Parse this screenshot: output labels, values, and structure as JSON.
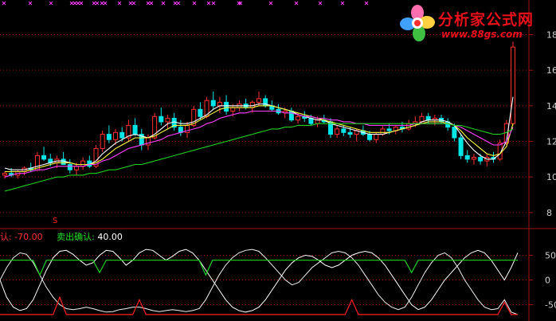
{
  "watermark": {
    "title": "分析家公式网",
    "url": "www.88gs.com",
    "logo": "flower-logo-icon"
  },
  "colors": {
    "background": "#000000",
    "up": "#ff3030",
    "down": "#00e5e5",
    "ma_short": "#ffffff",
    "ma_mid": "#ffff40",
    "ma_long": "#ff40ff",
    "ma_slow": "#20d020",
    "osc_a": "#ffffff",
    "osc_b": "#f0f0f0",
    "buy_line": "#20d020",
    "sell_line": "#ff2020",
    "grid": "#a01010"
  },
  "legend": {
    "buy_label": "认: ",
    "buy_value": "-70.00",
    "sell_label": "卖出确认: ",
    "sell_value": "40.00"
  },
  "signal_marker": "S",
  "chart_data": [
    {
      "type": "candlestick",
      "title": "",
      "ytick_labels": [
        "18",
        "16",
        "14",
        "12",
        "10",
        "8"
      ],
      "ylim": [
        7.5,
        19.5
      ],
      "grid": true,
      "candles": [
        [
          10.1,
          10.3,
          9.9,
          10.2
        ],
        [
          10.2,
          10.5,
          10.0,
          10.1
        ],
        [
          10.1,
          10.4,
          9.9,
          10.3
        ],
        [
          10.3,
          10.6,
          10.1,
          10.5
        ],
        [
          10.5,
          10.8,
          10.3,
          10.4
        ],
        [
          10.4,
          11.4,
          10.3,
          11.2
        ],
        [
          11.2,
          11.7,
          10.9,
          11.0
        ],
        [
          11.0,
          11.3,
          10.6,
          10.8
        ],
        [
          10.8,
          11.2,
          10.5,
          11.0
        ],
        [
          11.0,
          11.4,
          10.8,
          10.7
        ],
        [
          10.7,
          11.0,
          10.2,
          10.4
        ],
        [
          10.4,
          10.8,
          10.1,
          10.6
        ],
        [
          10.6,
          11.1,
          10.4,
          10.9
        ],
        [
          10.9,
          11.2,
          10.5,
          10.6
        ],
        [
          10.6,
          11.8,
          10.5,
          11.6
        ],
        [
          11.6,
          12.6,
          11.4,
          12.4
        ],
        [
          12.4,
          12.9,
          11.9,
          12.1
        ],
        [
          12.1,
          12.7,
          11.8,
          12.5
        ],
        [
          12.5,
          12.8,
          12.0,
          12.2
        ],
        [
          12.2,
          13.2,
          12.0,
          12.9
        ],
        [
          12.9,
          13.3,
          12.3,
          12.4
        ],
        [
          12.4,
          12.7,
          11.5,
          11.8
        ],
        [
          11.8,
          12.4,
          11.5,
          12.2
        ],
        [
          12.2,
          13.6,
          12.1,
          13.4
        ],
        [
          13.4,
          13.9,
          12.9,
          13.1
        ],
        [
          13.1,
          13.5,
          12.7,
          13.3
        ],
        [
          13.3,
          13.6,
          12.6,
          12.8
        ],
        [
          12.8,
          13.2,
          12.3,
          12.5
        ],
        [
          12.5,
          13.1,
          12.2,
          12.9
        ],
        [
          12.9,
          14.0,
          12.8,
          13.8
        ],
        [
          13.8,
          14.2,
          13.2,
          13.4
        ],
        [
          13.4,
          14.5,
          13.3,
          14.3
        ],
        [
          14.3,
          14.8,
          13.8,
          14.0
        ],
        [
          14.0,
          14.5,
          13.6,
          14.2
        ],
        [
          14.2,
          14.6,
          13.5,
          13.7
        ],
        [
          13.7,
          14.1,
          13.4,
          13.9
        ],
        [
          13.9,
          14.3,
          13.7,
          14.1
        ],
        [
          14.1,
          14.4,
          13.8,
          13.9
        ],
        [
          13.9,
          14.3,
          13.6,
          14.2
        ],
        [
          14.2,
          14.8,
          14.0,
          14.4
        ],
        [
          14.4,
          14.6,
          13.9,
          14.0
        ],
        [
          14.0,
          14.3,
          13.7,
          13.8
        ],
        [
          13.8,
          14.1,
          13.5,
          13.6
        ],
        [
          13.6,
          13.9,
          13.3,
          13.7
        ],
        [
          13.7,
          13.9,
          13.1,
          13.2
        ],
        [
          13.2,
          13.6,
          13.0,
          13.4
        ],
        [
          13.4,
          13.7,
          13.1,
          13.3
        ],
        [
          13.3,
          13.5,
          12.9,
          13.0
        ],
        [
          13.0,
          13.4,
          12.8,
          13.2
        ],
        [
          13.2,
          13.5,
          13.0,
          13.1
        ],
        [
          13.1,
          13.3,
          12.2,
          12.4
        ],
        [
          12.4,
          12.9,
          12.2,
          12.7
        ],
        [
          12.7,
          12.9,
          12.3,
          12.5
        ],
        [
          12.5,
          12.8,
          12.2,
          12.4
        ],
        [
          12.4,
          12.7,
          12.0,
          12.6
        ],
        [
          12.6,
          12.9,
          12.3,
          12.4
        ],
        [
          12.4,
          12.6,
          12.0,
          12.1
        ],
        [
          12.1,
          12.5,
          11.9,
          12.4
        ],
        [
          12.4,
          12.9,
          12.3,
          12.7
        ],
        [
          12.7,
          13.0,
          12.4,
          12.6
        ],
        [
          12.6,
          12.9,
          12.4,
          12.8
        ],
        [
          12.8,
          13.1,
          12.5,
          12.7
        ],
        [
          12.7,
          13.2,
          12.6,
          13.0
        ],
        [
          13.0,
          13.4,
          12.8,
          13.1
        ],
        [
          13.1,
          13.6,
          13.0,
          13.4
        ],
        [
          13.4,
          13.6,
          13.0,
          13.2
        ],
        [
          13.2,
          13.5,
          12.9,
          13.3
        ],
        [
          13.3,
          13.5,
          13.0,
          13.1
        ],
        [
          13.1,
          13.3,
          12.6,
          12.8
        ],
        [
          12.8,
          13.0,
          12.0,
          12.2
        ],
        [
          12.2,
          12.4,
          11.0,
          11.2
        ],
        [
          11.2,
          11.5,
          10.8,
          11.0
        ],
        [
          11.0,
          11.3,
          10.7,
          11.1
        ],
        [
          11.1,
          11.3,
          10.7,
          10.9
        ],
        [
          10.9,
          11.3,
          10.6,
          11.1
        ],
        [
          11.1,
          11.4,
          10.8,
          11.0
        ],
        [
          11.0,
          12.1,
          10.9,
          11.9
        ],
        [
          11.9,
          13.2,
          11.8,
          13.0
        ],
        [
          13.0,
          17.6,
          12.9,
          17.3
        ]
      ],
      "series": [
        {
          "name": "",
          "values": [
            10.5,
            10.4,
            10.4,
            10.4,
            10.5,
            10.6,
            10.7,
            10.8,
            10.9,
            10.9,
            10.8,
            10.7,
            10.7,
            10.7,
            10.9,
            11.3,
            11.6,
            11.9,
            12.1,
            12.3,
            12.4,
            12.3,
            12.2,
            12.4,
            12.7,
            13.0,
            13.1,
            13.0,
            13.0,
            13.1,
            13.3,
            13.5,
            13.8,
            14.0,
            14.0,
            14.0,
            14.0,
            14.0,
            14.0,
            14.1,
            14.1,
            14.0,
            13.9,
            13.8,
            13.7,
            13.5,
            13.4,
            13.3,
            13.2,
            13.2,
            13.0,
            12.9,
            12.8,
            12.7,
            12.6,
            12.5,
            12.4,
            12.4,
            12.4,
            12.5,
            12.6,
            12.7,
            12.8,
            12.9,
            13.1,
            13.2,
            13.2,
            13.2,
            13.1,
            12.9,
            12.4,
            11.9,
            11.5,
            11.2,
            11.0,
            11.0,
            11.3,
            12.0,
            14.5
          ]
        },
        {
          "name": "",
          "values": [
            10.3,
            10.3,
            10.3,
            10.3,
            10.4,
            10.5,
            10.6,
            10.7,
            10.8,
            10.8,
            10.8,
            10.7,
            10.7,
            10.7,
            10.8,
            11.0,
            11.3,
            11.6,
            11.8,
            12.0,
            12.2,
            12.2,
            12.2,
            12.3,
            12.5,
            12.7,
            12.9,
            12.9,
            12.9,
            13.0,
            13.2,
            13.4,
            13.6,
            13.8,
            13.9,
            13.9,
            13.9,
            13.9,
            13.9,
            14.0,
            14.0,
            14.0,
            13.9,
            13.8,
            13.7,
            13.6,
            13.5,
            13.4,
            13.3,
            13.2,
            13.1,
            13.0,
            12.9,
            12.8,
            12.7,
            12.6,
            12.5,
            12.5,
            12.5,
            12.5,
            12.6,
            12.7,
            12.8,
            12.9,
            13.0,
            13.1,
            13.1,
            13.1,
            13.0,
            12.9,
            12.6,
            12.2,
            11.9,
            11.6,
            11.3,
            11.2,
            11.3,
            11.7,
            13.0
          ]
        },
        {
          "name": "",
          "values": [
            10.0,
            10.1,
            10.2,
            10.2,
            10.3,
            10.4,
            10.4,
            10.5,
            10.6,
            10.6,
            10.6,
            10.6,
            10.6,
            10.7,
            10.7,
            10.9,
            11.0,
            11.2,
            11.4,
            11.6,
            11.7,
            11.8,
            11.9,
            12.0,
            12.1,
            12.3,
            12.4,
            12.5,
            12.6,
            12.7,
            12.8,
            13.0,
            13.1,
            13.3,
            13.4,
            13.5,
            13.6,
            13.6,
            13.7,
            13.7,
            13.7,
            13.7,
            13.7,
            13.6,
            13.6,
            13.5,
            13.4,
            13.4,
            13.3,
            13.3,
            13.2,
            13.2,
            13.1,
            13.1,
            13.0,
            13.0,
            12.9,
            12.9,
            12.9,
            12.9,
            12.9,
            12.9,
            12.9,
            13.0,
            13.0,
            13.0,
            13.0,
            13.0,
            13.0,
            12.9,
            12.8,
            12.6,
            12.4,
            12.2,
            12.0,
            11.8,
            11.8,
            12.0,
            12.8
          ]
        },
        {
          "name": "",
          "values": [
            9.2,
            9.3,
            9.4,
            9.5,
            9.6,
            9.7,
            9.8,
            9.9,
            10.0,
            10.0,
            10.1,
            10.1,
            10.1,
            10.2,
            10.2,
            10.3,
            10.4,
            10.4,
            10.5,
            10.6,
            10.7,
            10.7,
            10.8,
            10.9,
            11.0,
            11.1,
            11.2,
            11.3,
            11.4,
            11.5,
            11.6,
            11.7,
            11.8,
            11.9,
            12.0,
            12.1,
            12.2,
            12.3,
            12.4,
            12.5,
            12.6,
            12.7,
            12.7,
            12.8,
            12.8,
            12.9,
            12.9,
            12.9,
            13.0,
            13.0,
            13.0,
            13.0,
            13.0,
            13.0,
            13.0,
            13.0,
            13.0,
            13.0,
            13.0,
            13.0,
            13.0,
            13.0,
            13.0,
            13.0,
            13.0,
            13.0,
            13.0,
            13.0,
            13.0,
            12.9,
            12.9,
            12.8,
            12.7,
            12.6,
            12.5,
            12.4,
            12.4,
            12.5,
            12.7
          ]
        }
      ]
    },
    {
      "type": "line",
      "title": "",
      "ytick_labels": [
        "50",
        "0",
        "-50"
      ],
      "ylim": [
        -75,
        75
      ],
      "grid": true,
      "reference_lines": [
        40,
        -70
      ],
      "series": [
        {
          "name": "",
          "values": [
            0,
            -35,
            -55,
            -62,
            -58,
            -40,
            -10,
            20,
            45,
            58,
            60,
            52,
            40,
            30,
            35,
            50,
            60,
            58,
            45,
            30,
            40,
            55,
            62,
            60,
            50,
            40,
            48,
            58,
            62,
            55,
            40,
            20,
            0,
            -20,
            -40,
            -55,
            -62,
            -65,
            -62,
            -55,
            -40,
            -20,
            0,
            20,
            35,
            45,
            50,
            48,
            40,
            30,
            25,
            30,
            40,
            50,
            55,
            58,
            55,
            45,
            30,
            10,
            -10,
            -30,
            -50,
            -60,
            -55,
            -40,
            -20,
            0,
            15,
            30,
            45,
            55,
            60,
            55,
            40,
            20,
            0,
            25,
            55
          ]
        },
        {
          "name": "",
          "values": [
            0,
            25,
            45,
            55,
            52,
            35,
            10,
            -15,
            -35,
            -50,
            -58,
            -60,
            -58,
            -55,
            -58,
            -62,
            -65,
            -64,
            -60,
            -58,
            -55,
            -55,
            -58,
            -62,
            -64,
            -62,
            -60,
            -62,
            -64,
            -62,
            -58,
            -40,
            -15,
            10,
            30,
            45,
            55,
            60,
            62,
            58,
            45,
            30,
            15,
            0,
            -10,
            -5,
            10,
            25,
            35,
            45,
            55,
            58,
            55,
            45,
            30,
            10,
            -10,
            -30,
            -45,
            -55,
            -60,
            -55,
            -35,
            -10,
            15,
            35,
            50,
            55,
            45,
            25,
            0,
            -20,
            -40,
            -55,
            -60,
            -58,
            -40,
            -65,
            -70
          ]
        },
        {
          "name": "",
          "values": [
            40,
            40,
            40,
            40,
            40,
            40,
            10,
            40,
            40,
            40,
            40,
            40,
            40,
            40,
            40,
            15,
            40,
            40,
            40,
            40,
            40,
            40,
            40,
            40,
            40,
            40,
            40,
            40,
            40,
            40,
            40,
            10,
            40,
            40,
            40,
            40,
            40,
            40,
            40,
            40,
            40,
            40,
            40,
            40,
            40,
            40,
            40,
            40,
            40,
            40,
            40,
            40,
            40,
            40,
            40,
            40,
            40,
            40,
            40,
            40,
            40,
            40,
            15,
            40,
            40,
            40,
            40,
            40,
            40,
            40,
            40,
            40,
            40,
            40,
            40,
            40,
            40,
            40,
            40
          ]
        },
        {
          "name": "",
          "values": [
            -70,
            -70,
            -70,
            -70,
            -70,
            -70,
            -70,
            -70,
            -70,
            -35,
            -70,
            -70,
            -70,
            -70,
            -70,
            -70,
            -70,
            -70,
            -70,
            -70,
            -70,
            -40,
            -70,
            -70,
            -70,
            -70,
            -70,
            -70,
            -70,
            -70,
            -70,
            -70,
            -70,
            -70,
            -70,
            -70,
            -70,
            -70,
            -70,
            -70,
            -70,
            -70,
            -70,
            -70,
            -70,
            -70,
            -70,
            -70,
            -70,
            -70,
            -70,
            -70,
            -70,
            -40,
            -70,
            -70,
            -70,
            -70,
            -70,
            -70,
            -70,
            -70,
            -70,
            -70,
            -70,
            -70,
            -70,
            -70,
            -70,
            -70,
            -70,
            -70,
            -70,
            -70,
            -70,
            -70,
            -45,
            -70,
            -70
          ]
        }
      ]
    }
  ]
}
